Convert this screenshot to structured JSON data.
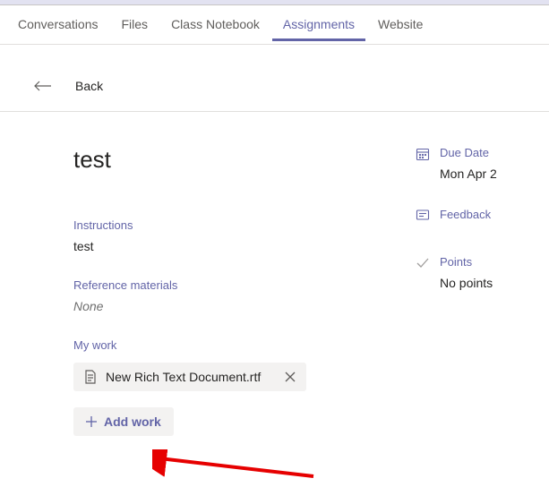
{
  "tabs": {
    "conversations": "Conversations",
    "files": "Files",
    "notebook": "Class Notebook",
    "assignments": "Assignments",
    "website": "Website"
  },
  "back": {
    "label": "Back"
  },
  "assignment": {
    "title": "test",
    "instructions_label": "Instructions",
    "instructions_value": "test",
    "reference_label": "Reference materials",
    "reference_value": "None",
    "mywork_label": "My work",
    "file_name": "New Rich Text Document.rtf",
    "add_work_label": "Add work"
  },
  "meta": {
    "due_label": "Due Date",
    "due_value": "Mon Apr 2",
    "feedback_label": "Feedback",
    "points_label": "Points",
    "points_value": "No points"
  }
}
